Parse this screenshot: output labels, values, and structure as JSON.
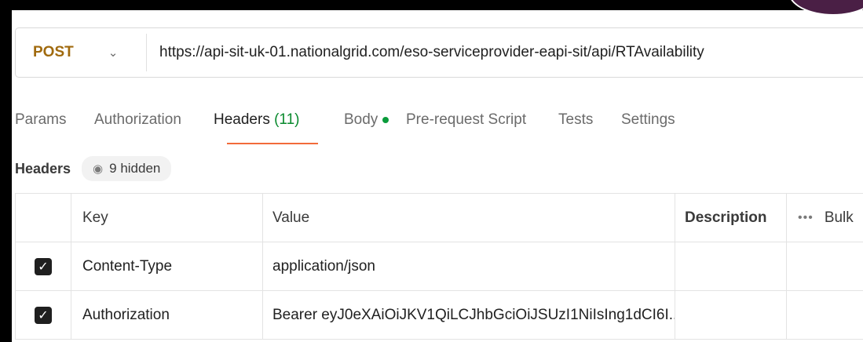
{
  "request": {
    "method": "POST",
    "url": "https://api-sit-uk-01.nationalgrid.com/eso-serviceprovider-eapi-sit/api/RTAvailability"
  },
  "tabs": [
    {
      "label": "Params"
    },
    {
      "label": "Authorization"
    },
    {
      "label": "Headers",
      "count": "(11)",
      "active": true
    },
    {
      "label": "Body",
      "indicator": "green-dot"
    },
    {
      "label": "Pre-request Script"
    },
    {
      "label": "Tests"
    },
    {
      "label": "Settings"
    }
  ],
  "headers_section": {
    "label": "Headers",
    "hidden_text": "9 hidden"
  },
  "table": {
    "columns": [
      "Key",
      "Value",
      "Description",
      "Bulk"
    ],
    "rows": [
      {
        "checked": true,
        "key": "Content-Type",
        "value": "application/json"
      },
      {
        "checked": true,
        "key": "Authorization",
        "value": "Bearer eyJ0eXAiOiJKV1QiLCJhbGciOiJSUzI1NiIsIng1dCI6I..."
      }
    ]
  },
  "colors": {
    "method": "#a06a0e",
    "active_tab_underline": "#f26b3a",
    "count": "#0a8a2e",
    "body_dot": "#0a9b3b"
  }
}
